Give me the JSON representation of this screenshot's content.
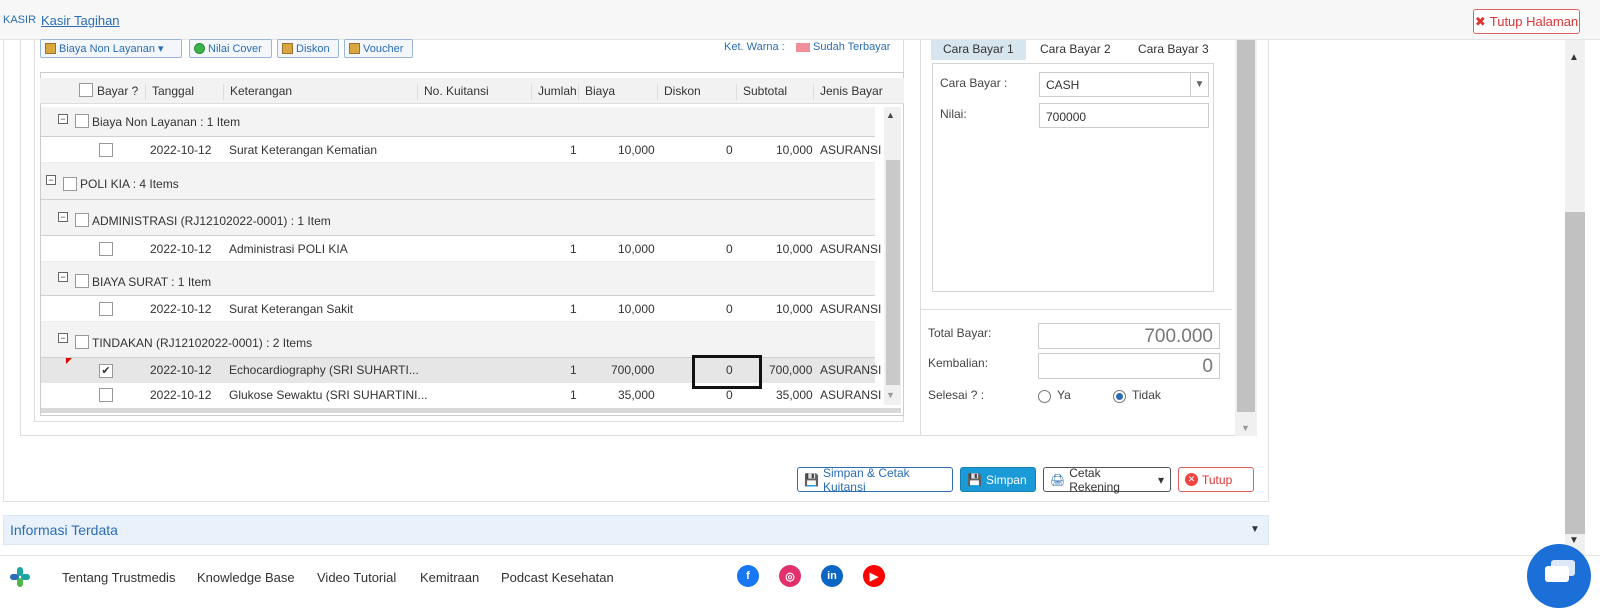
{
  "header": {
    "module": "KASIR",
    "page": "Kasir Tagihan",
    "close_page": "Tutup Halaman"
  },
  "toolbar": {
    "btn1": "Biaya Non Layanan",
    "btn2": "Nilai Cover",
    "btn3": "Diskon",
    "btn4": "Voucher",
    "legend_label": "Ket. Warna :",
    "legend_item": "Sudah Terbayar",
    "legend_color": "#f08f9a"
  },
  "table": {
    "headers": {
      "bayar": "Bayar ?",
      "tanggal": "Tanggal",
      "keterangan": "Keterangan",
      "kuitansi": "No. Kuitansi",
      "jumlah": "Jumlah",
      "biaya": "Biaya",
      "diskon": "Diskon",
      "subtotal": "Subtotal",
      "jenis": "Jenis Bayar"
    },
    "groups": [
      {
        "label": "Biaya Non Layanan : 1 Item"
      },
      {
        "label": "POLI KIA : 4 Items"
      },
      {
        "label": "ADMINISTRASI (RJ12102022-0001) : 1 Item"
      },
      {
        "label": "BIAYA SURAT : 1 Item"
      },
      {
        "label": "TINDAKAN (RJ12102022-0001) : 2 Items"
      }
    ],
    "rows": [
      {
        "tanggal": "2022-10-12",
        "keterangan": "Surat Keterangan Kematian",
        "jumlah": "1",
        "biaya": "10,000",
        "diskon": "0",
        "subtotal": "10,000",
        "jenis": "ASURANSI",
        "checked": false
      },
      {
        "tanggal": "2022-10-12",
        "keterangan": "Administrasi POLI KIA",
        "jumlah": "1",
        "biaya": "10,000",
        "diskon": "0",
        "subtotal": "10,000",
        "jenis": "ASURANSI",
        "checked": false
      },
      {
        "tanggal": "2022-10-12",
        "keterangan": "Surat Keterangan Sakit",
        "jumlah": "1",
        "biaya": "10,000",
        "diskon": "0",
        "subtotal": "10,000",
        "jenis": "ASURANSI",
        "checked": false
      },
      {
        "tanggal": "2022-10-12",
        "keterangan": "Echocardiography (SRI SUHARTI...",
        "jumlah": "1",
        "biaya": "700,000",
        "diskon": "0",
        "subtotal": "700,000",
        "jenis": "ASURANSI",
        "checked": true
      },
      {
        "tanggal": "2022-10-12",
        "keterangan": "Glukose Sewaktu (SRI SUHARTINI...",
        "jumlah": "1",
        "biaya": "35,000",
        "diskon": "0",
        "subtotal": "35,000",
        "jenis": "ASURANSI",
        "checked": false
      }
    ]
  },
  "payment": {
    "tabs": [
      "Cara Bayar 1",
      "Cara Bayar 2",
      "Cara Bayar 3"
    ],
    "cara_label": "Cara Bayar :",
    "cara_value": "CASH",
    "nilai_label": "Nilai:",
    "nilai_value": "700000",
    "total_label": "Total Bayar:",
    "total_value": "700.000",
    "kembalian_label": "Kembalian:",
    "kembalian_value": "0",
    "selesai_label": "Selesai ? :",
    "ya": "Ya",
    "tidak": "Tidak",
    "selected": "Tidak"
  },
  "actions": {
    "save_print": "Simpan & Cetak Kuitansi",
    "save": "Simpan",
    "print_account": "Cetak Rekening",
    "close": "Tutup"
  },
  "info_section": "Informasi Terdata",
  "footer": {
    "links": [
      "Tentang Trustmedis",
      "Knowledge Base",
      "Video Tutorial",
      "Kemitraan",
      "Podcast Kesehatan"
    ],
    "social": [
      {
        "name": "facebook-icon",
        "glyph": "f",
        "color": "#1877f2"
      },
      {
        "name": "instagram-icon",
        "glyph": "◎",
        "color": "#e1306c"
      },
      {
        "name": "linkedin-icon",
        "glyph": "in",
        "color": "#0a66c2"
      },
      {
        "name": "youtube-icon",
        "glyph": "▶",
        "color": "#ff0000"
      }
    ]
  }
}
